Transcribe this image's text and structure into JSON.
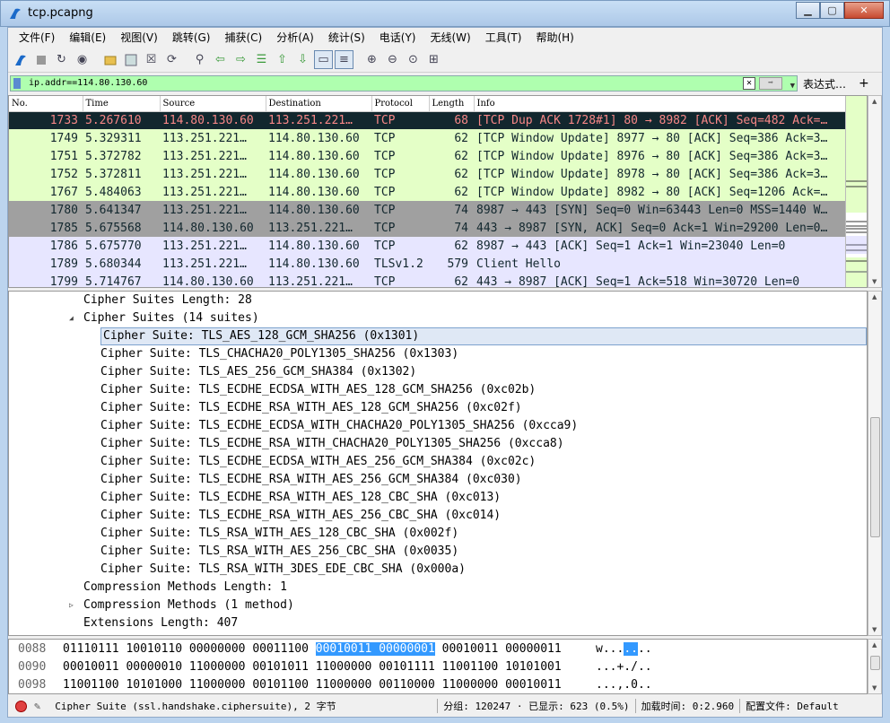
{
  "window": {
    "title": "tcp.pcapng"
  },
  "menu": [
    "文件(F)",
    "编辑(E)",
    "视图(V)",
    "跳转(G)",
    "捕获(C)",
    "分析(A)",
    "统计(S)",
    "电话(Y)",
    "无线(W)",
    "工具(T)",
    "帮助(H)"
  ],
  "filter": {
    "value": "ip.addr==114.80.130.60",
    "expression_label": "表达式…",
    "plus_label": "+"
  },
  "columns": [
    "No.",
    "Time",
    "Source",
    "Destination",
    "Protocol",
    "Length",
    "Info"
  ],
  "packets": [
    {
      "no": "1733",
      "time": "5.267610",
      "src": "114.80.130.60",
      "dst": "113.251.221…",
      "proto": "TCP",
      "len": "68",
      "info": "[TCP Dup ACK 1728#1] 80 → 8982 [ACK] Seq=482 Ack=…",
      "bg": "#12272e",
      "fg": "#f78787"
    },
    {
      "no": "1749",
      "time": "5.329311",
      "src": "113.251.221…",
      "dst": "114.80.130.60",
      "proto": "TCP",
      "len": "62",
      "info": "[TCP Window Update] 8977 → 80 [ACK] Seq=386 Ack=3…",
      "bg": "#e4ffc7",
      "fg": "#12272e"
    },
    {
      "no": "1751",
      "time": "5.372782",
      "src": "113.251.221…",
      "dst": "114.80.130.60",
      "proto": "TCP",
      "len": "62",
      "info": "[TCP Window Update] 8976 → 80 [ACK] Seq=386 Ack=3…",
      "bg": "#e4ffc7",
      "fg": "#12272e"
    },
    {
      "no": "1752",
      "time": "5.372811",
      "src": "113.251.221…",
      "dst": "114.80.130.60",
      "proto": "TCP",
      "len": "62",
      "info": "[TCP Window Update] 8978 → 80 [ACK] Seq=386 Ack=3…",
      "bg": "#e4ffc7",
      "fg": "#12272e"
    },
    {
      "no": "1767",
      "time": "5.484063",
      "src": "113.251.221…",
      "dst": "114.80.130.60",
      "proto": "TCP",
      "len": "62",
      "info": "[TCP Window Update] 8982 → 80 [ACK] Seq=1206 Ack=…",
      "bg": "#e4ffc7",
      "fg": "#12272e"
    },
    {
      "no": "1780",
      "time": "5.641347",
      "src": "113.251.221…",
      "dst": "114.80.130.60",
      "proto": "TCP",
      "len": "74",
      "info": "8987 → 443 [SYN] Seq=0 Win=63443 Len=0 MSS=1440 W…",
      "bg": "#a0a0a0",
      "fg": "#12272e"
    },
    {
      "no": "1785",
      "time": "5.675568",
      "src": "114.80.130.60",
      "dst": "113.251.221…",
      "proto": "TCP",
      "len": "74",
      "info": "443 → 8987 [SYN, ACK] Seq=0 Ack=1 Win=29200 Len=0…",
      "bg": "#a0a0a0",
      "fg": "#12272e"
    },
    {
      "no": "1786",
      "time": "5.675770",
      "src": "113.251.221…",
      "dst": "114.80.130.60",
      "proto": "TCP",
      "len": "62",
      "info": "8987 → 443 [ACK] Seq=1 Ack=1 Win=23040 Len=0",
      "bg": "#e7e6ff",
      "fg": "#12272e"
    },
    {
      "no": "1789",
      "time": "5.680344",
      "src": "113.251.221…",
      "dst": "114.80.130.60",
      "proto": "TLSv1.2",
      "len": "579",
      "info": "Client Hello",
      "bg": "#e7e6ff",
      "fg": "#12272e"
    },
    {
      "no": "1799",
      "time": "5.714767",
      "src": "114.80.130.60",
      "dst": "113.251.221…",
      "proto": "TCP",
      "len": "62",
      "info": "443 → 8987 [ACK] Seq=1 Ack=518 Win=30720 Len=0",
      "bg": "#e7e6ff",
      "fg": "#12272e"
    }
  ],
  "details": [
    {
      "text": "Cipher Suites Length: 28",
      "indent": 1,
      "expander": ""
    },
    {
      "text": "Cipher Suites (14 suites)",
      "indent": 1,
      "expander": "◢"
    },
    {
      "text": "Cipher Suite: TLS_AES_128_GCM_SHA256 (0x1301)",
      "indent": 2,
      "expander": "",
      "selected": true
    },
    {
      "text": "Cipher Suite: TLS_CHACHA20_POLY1305_SHA256 (0x1303)",
      "indent": 2,
      "expander": ""
    },
    {
      "text": "Cipher Suite: TLS_AES_256_GCM_SHA384 (0x1302)",
      "indent": 2,
      "expander": ""
    },
    {
      "text": "Cipher Suite: TLS_ECDHE_ECDSA_WITH_AES_128_GCM_SHA256 (0xc02b)",
      "indent": 2,
      "expander": ""
    },
    {
      "text": "Cipher Suite: TLS_ECDHE_RSA_WITH_AES_128_GCM_SHA256 (0xc02f)",
      "indent": 2,
      "expander": ""
    },
    {
      "text": "Cipher Suite: TLS_ECDHE_ECDSA_WITH_CHACHA20_POLY1305_SHA256 (0xcca9)",
      "indent": 2,
      "expander": ""
    },
    {
      "text": "Cipher Suite: TLS_ECDHE_RSA_WITH_CHACHA20_POLY1305_SHA256 (0xcca8)",
      "indent": 2,
      "expander": ""
    },
    {
      "text": "Cipher Suite: TLS_ECDHE_ECDSA_WITH_AES_256_GCM_SHA384 (0xc02c)",
      "indent": 2,
      "expander": ""
    },
    {
      "text": "Cipher Suite: TLS_ECDHE_RSA_WITH_AES_256_GCM_SHA384 (0xc030)",
      "indent": 2,
      "expander": ""
    },
    {
      "text": "Cipher Suite: TLS_ECDHE_RSA_WITH_AES_128_CBC_SHA (0xc013)",
      "indent": 2,
      "expander": ""
    },
    {
      "text": "Cipher Suite: TLS_ECDHE_RSA_WITH_AES_256_CBC_SHA (0xc014)",
      "indent": 2,
      "expander": ""
    },
    {
      "text": "Cipher Suite: TLS_RSA_WITH_AES_128_CBC_SHA (0x002f)",
      "indent": 2,
      "expander": ""
    },
    {
      "text": "Cipher Suite: TLS_RSA_WITH_AES_256_CBC_SHA (0x0035)",
      "indent": 2,
      "expander": ""
    },
    {
      "text": "Cipher Suite: TLS_RSA_WITH_3DES_EDE_CBC_SHA (0x000a)",
      "indent": 2,
      "expander": ""
    },
    {
      "text": "Compression Methods Length: 1",
      "indent": 1,
      "expander": ""
    },
    {
      "text": "Compression Methods (1 method)",
      "indent": 1,
      "expander": "▷"
    },
    {
      "text": "Extensions Length: 407",
      "indent": 1,
      "expander": ""
    }
  ],
  "hex": [
    {
      "offset": "0088",
      "pre": "01110111 10010110 00000000 00011100 ",
      "hl": "00010011 00000001",
      "post": " 00010011 00000011",
      "ascii_pre": "w...",
      "ascii_hl": "..",
      "ascii_post": ".."
    },
    {
      "offset": "0090",
      "pre": "00010011 00000010 11000000 00101011 11000000 00101111 11001100 10101001",
      "hl": "",
      "post": "",
      "ascii_pre": "...+./..",
      "ascii_hl": "",
      "ascii_post": ""
    },
    {
      "offset": "0098",
      "pre": "11001100 10101000 11000000 00101100 11000000 00110000 11000000 00010011",
      "hl": "",
      "post": "",
      "ascii_pre": "...,.0..",
      "ascii_hl": "",
      "ascii_post": ""
    }
  ],
  "status": {
    "field": "Cipher Suite (ssl.handshake.ciphersuite), 2 字节",
    "packets": "分组: 120247 · 已显示: 623 (0.5%)",
    "load": "加载时间: 0:2.960",
    "profile": "配置文件: Default"
  },
  "icons": {
    "toolbar": [
      "shark-fin-icon",
      "stop-icon",
      "restart-icon",
      "options-icon",
      "open-icon",
      "save-icon",
      "close-file-icon",
      "reload-icon",
      "find-icon",
      "back-icon",
      "forward-icon",
      "goto-icon",
      "first-icon",
      "last-icon",
      "autoscroll-icon",
      "colorize-icon",
      "zoom-in-icon",
      "zoom-out-icon",
      "zoom-reset-icon",
      "resize-columns-icon"
    ]
  }
}
